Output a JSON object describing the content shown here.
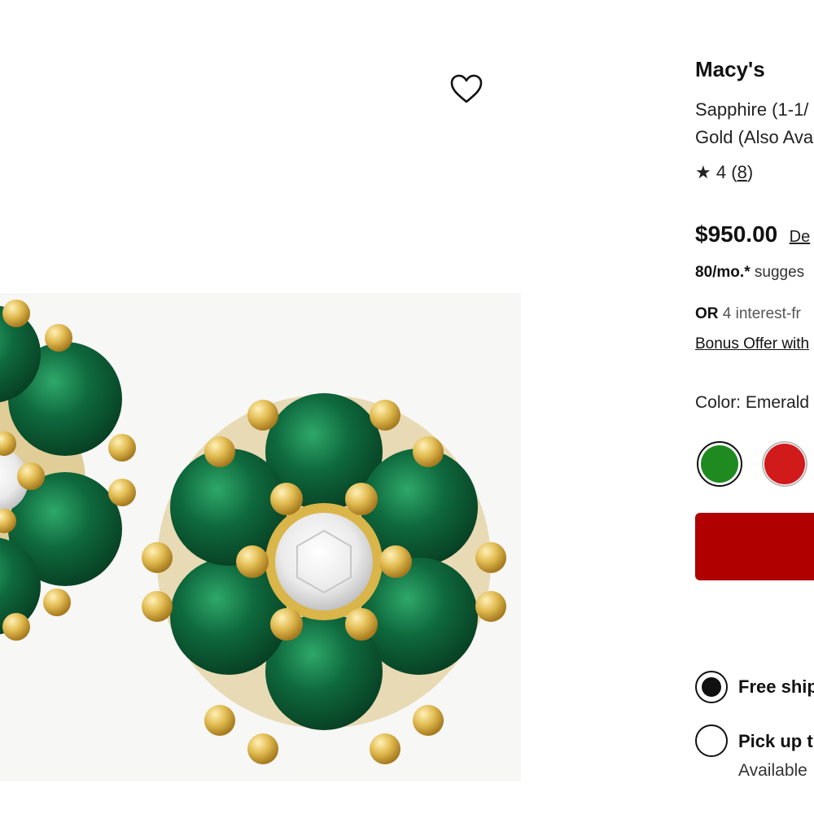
{
  "product": {
    "brand": "Macy's",
    "title_line1": "Sapphire (1-1/",
    "title_line2": "Gold (Also Ava",
    "rating_star": "★",
    "rating_value": "4",
    "rating_count": "8",
    "price": "$950.00",
    "price_link": "De",
    "monthly_amount": "80/mo.*",
    "monthly_text": "sugges",
    "or_word": "OR",
    "or_text": "4 interest-fr",
    "bonus_link": "Bonus Offer with",
    "color_label": "Color: Emerald",
    "swatches": [
      {
        "name": "Emerald",
        "color": "#1f8a1f",
        "selected": true
      },
      {
        "name": "Ruby",
        "color": "#d11a1a",
        "selected": false
      }
    ],
    "add_to_bag_color": "#b00000"
  },
  "fulfillment": {
    "option1_label": "Free ship",
    "option1_selected": true,
    "option2_label": "Pick up t",
    "option2_sub": "Available"
  },
  "icons": {
    "wishlist": "heart-outline-icon",
    "star": "star-icon"
  },
  "image": {
    "alt": "emerald and diamond flower cluster stud earrings in gold"
  }
}
